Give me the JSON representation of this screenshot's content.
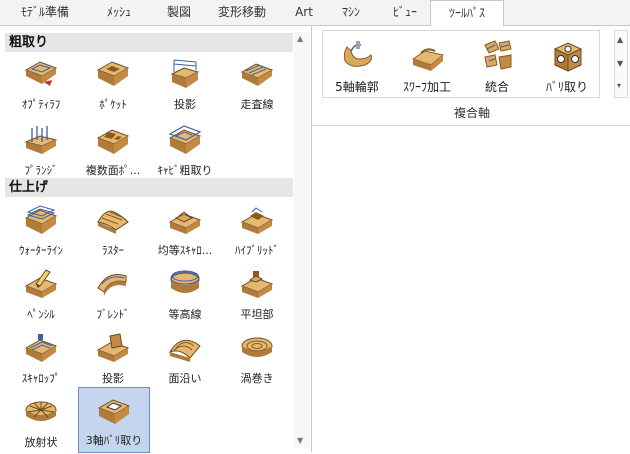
{
  "tabs": [
    {
      "label": "ﾓﾃﾞﾙ準備"
    },
    {
      "label": "ﾒｯｼｭ"
    },
    {
      "label": "製図"
    },
    {
      "label": "変形移動"
    },
    {
      "label": "Art"
    },
    {
      "label": "ﾏｼﾝ"
    },
    {
      "label": "ﾋﾞｭｰ"
    },
    {
      "label": "ﾂｰﾙﾊﾟｽ"
    }
  ],
  "active_tab": "ﾂｰﾙﾊﾟｽ",
  "ribbon": {
    "buttons": [
      {
        "label": "5軸輪郭",
        "icon": "5axis-contour-icon"
      },
      {
        "label": "ｽﾜｰﾌ加工",
        "icon": "swarf-machining-icon"
      },
      {
        "label": "統合",
        "icon": "merge-icon"
      },
      {
        "label": "ﾊﾞﾘ取り",
        "icon": "deburr-icon"
      }
    ],
    "group_label": "複合軸"
  },
  "gallery": {
    "sections": [
      {
        "title": "粗取り",
        "items": [
          {
            "label": "ｵﾌﾟﾃｨﾗﾌ",
            "icon": "optirough-icon"
          },
          {
            "label": "ﾎﾟｹｯﾄ",
            "icon": "pocket-icon"
          },
          {
            "label": "投影",
            "icon": "projection-icon"
          },
          {
            "label": "走査線",
            "icon": "scan-line-icon"
          },
          {
            "label": "ﾌﾟﾗﾝｼﾞ",
            "icon": "plunge-icon"
          },
          {
            "label": "複数面ﾎﾟ...",
            "icon": "multi-surface-pocket-icon"
          },
          {
            "label": "ｷｬﾋﾞ粗取り",
            "icon": "cavity-rough-icon"
          }
        ]
      },
      {
        "title": "仕上げ",
        "items": [
          {
            "label": "ｳｫｰﾀｰﾗｲﾝ",
            "icon": "waterline-icon"
          },
          {
            "label": "ﾗｽﾀｰ",
            "icon": "raster-icon"
          },
          {
            "label": "均等ｽｷｬﾛ...",
            "icon": "equal-scallop-icon"
          },
          {
            "label": "ﾊｲﾌﾞﾘｯﾄﾞ",
            "icon": "hybrid-icon"
          },
          {
            "label": "ﾍﾟﾝｼﾙ",
            "icon": "pencil-icon"
          },
          {
            "label": "ﾌﾞﾚﾝﾄﾞ",
            "icon": "blend-icon"
          },
          {
            "label": "等高線",
            "icon": "contour-line-icon"
          },
          {
            "label": "平坦部",
            "icon": "flat-area-icon"
          },
          {
            "label": "ｽｷｬﾛｯﾌﾟ",
            "icon": "scallop-icon"
          },
          {
            "label": "投影",
            "icon": "projection-finish-icon"
          },
          {
            "label": "面沿い",
            "icon": "along-surface-icon"
          },
          {
            "label": "渦巻き",
            "icon": "spiral-icon"
          },
          {
            "label": "放射状",
            "icon": "radial-icon"
          },
          {
            "label": "3軸ﾊﾞﾘ取り",
            "icon": "3axis-deburr-icon"
          }
        ]
      }
    ],
    "selected_item": "3軸ﾊﾞﾘ取り"
  },
  "colors": {
    "selection_fill": "#c4d6ef",
    "selection_border": "#6e8fbf",
    "icon_wood": "#d9a95e",
    "icon_wood_dark": "#a97434",
    "toolpath_line": "#3a5fa8",
    "accent_red": "#d22b2b"
  }
}
